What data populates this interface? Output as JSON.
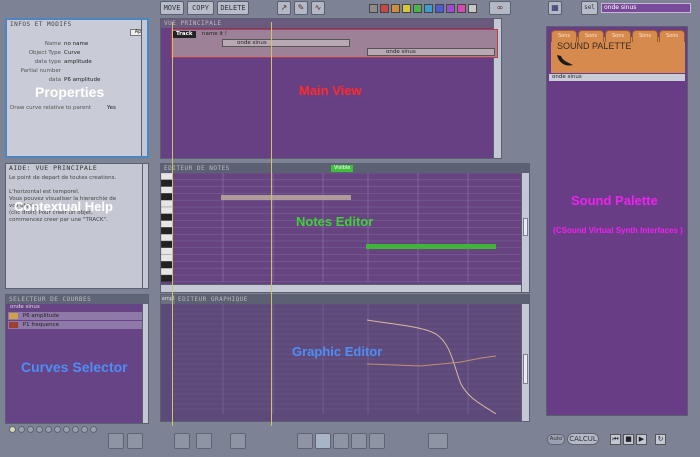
{
  "toolbar": {
    "move_label": "MOVE",
    "copy_label": "COPY",
    "delete_label": "DELETE",
    "colors": [
      "#8c8c8c",
      "#c84848",
      "#d28c3c",
      "#d2c83c",
      "#4cb44c",
      "#3c9cd2",
      "#4c5cd2",
      "#9c4cd2",
      "#d24cb4",
      "#c8c8c8"
    ],
    "top_right_field": "onde sinus",
    "top_right_button": "sel"
  },
  "properties": {
    "panel_title": "INFOS ET MODIFS",
    "overlay_label": "Properties",
    "corner_label": "Ap",
    "rows": [
      {
        "key": "Name",
        "value": "no name"
      },
      {
        "key": "Object Type",
        "value": "Curve"
      },
      {
        "key": "data type",
        "value": "amplitude"
      },
      {
        "key": "Partial number",
        "value": ""
      },
      {
        "key": "data",
        "value": "P6 amplitude"
      },
      {
        "key": "Draw curve relative to parent",
        "value": "Yes"
      }
    ]
  },
  "help": {
    "panel_title": "AIDE: VUE PRINCIPALE",
    "overlay_label": "Contextual Help",
    "lines": [
      "Le point de depart de toutes creations.",
      "",
      "L'horizontal est temporel.",
      "Vous pouvez visualiser la hierarchie de",
      "vos objets.",
      "(clic droit) Pour creer un objet,",
      "commencez creer par une \"TRACK\"."
    ]
  },
  "curves": {
    "panel_title": "SELECTEUR DE COURBES",
    "overlay_label": "Curves Selector",
    "header": "onde sinus",
    "items": [
      {
        "label": "P6 amplitude"
      },
      {
        "label": "P1 frequence"
      }
    ]
  },
  "main_view": {
    "panel_title": "VUE PRINCIPALE",
    "overlay_label": "Main View",
    "track_label": "Track",
    "track_name": "name it !",
    "object1": "onde sinus",
    "object2": "onde sinus"
  },
  "notes": {
    "panel_title": "EDITEUR DE NOTES",
    "overlay_label": "Notes Editor",
    "badge": "Visible"
  },
  "graph": {
    "panel_title": "EDITEUR GRAPHIQUE",
    "overlay_label": "Graphic Editor",
    "corner": "ampl"
  },
  "palette": {
    "title": "SOUND PALETTE",
    "overlay_label": "Sound Palette",
    "subtitle": "(CSound Virtual Synth Interfaces )",
    "item": "onde sinus",
    "tabs": [
      "Sons",
      "Sons",
      "Sons",
      "Sons",
      "Sons"
    ]
  },
  "transport": {
    "auto_label": "Auto",
    "calcul_label": "CALCUL"
  },
  "colors": {
    "panel_purple": "#673f83",
    "label_red": "#ff2a2a",
    "label_green": "#3ed23a",
    "label_blue": "#4d8ef5",
    "label_magenta": "#ee22ee",
    "label_white": "#ffffff"
  }
}
